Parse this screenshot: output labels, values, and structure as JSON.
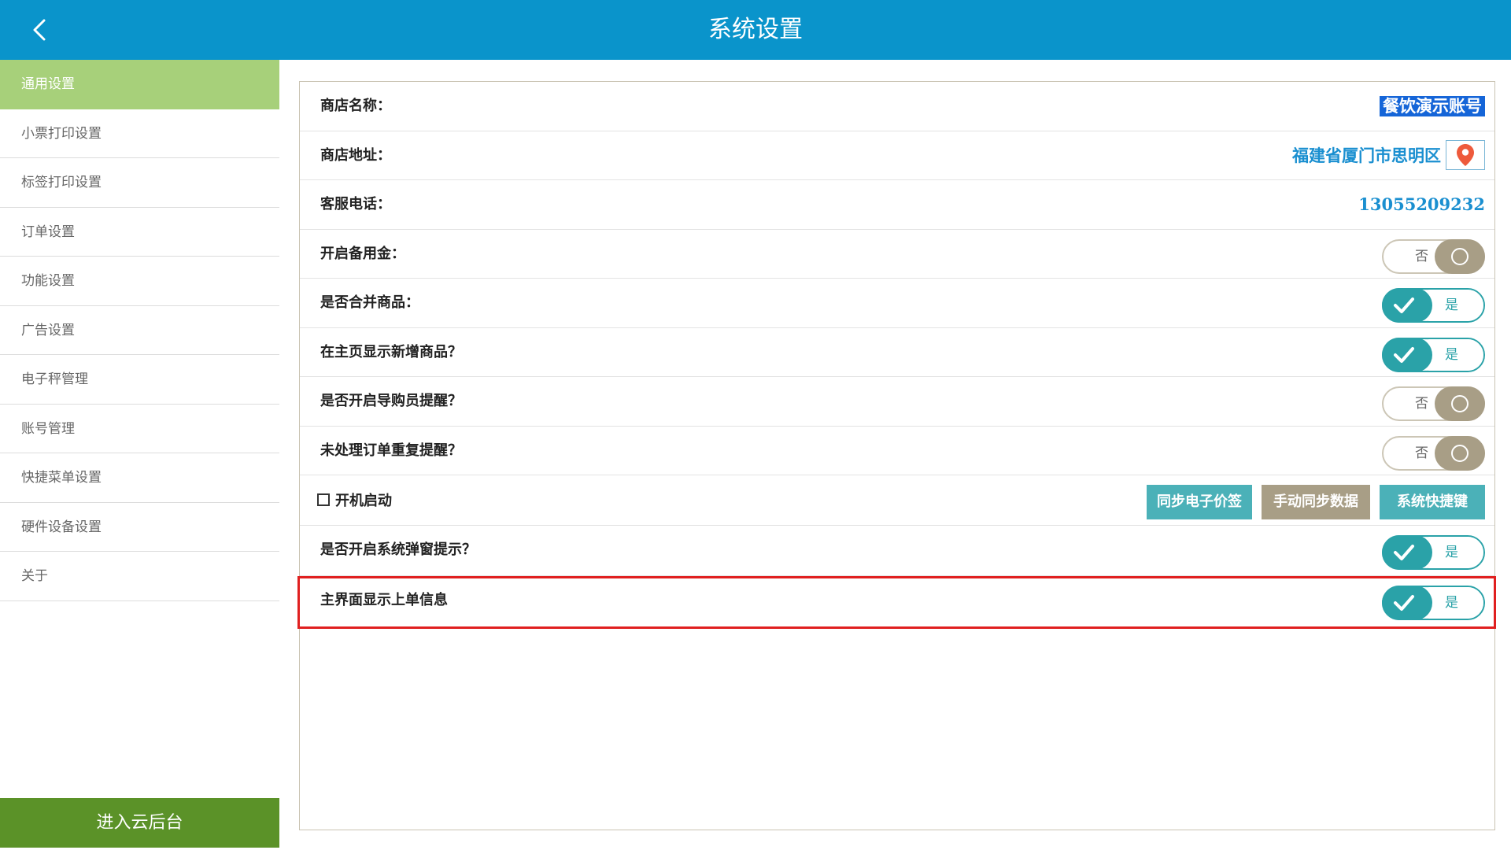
{
  "header": {
    "title": "系统设置",
    "back_icon": "chevron-left-icon"
  },
  "sidebar": {
    "items": [
      {
        "label": "通用设置",
        "active": true
      },
      {
        "label": "小票打印设置"
      },
      {
        "label": "标签打印设置"
      },
      {
        "label": "订单设置"
      },
      {
        "label": "功能设置"
      },
      {
        "label": "广告设置"
      },
      {
        "label": "电子秤管理"
      },
      {
        "label": "账号管理"
      },
      {
        "label": "快捷菜单设置"
      },
      {
        "label": "硬件设备设置"
      },
      {
        "label": "关于"
      }
    ],
    "cloud_button": "进入云后台"
  },
  "settings": {
    "store_name_label": "商店名称：",
    "store_name_value": "餐饮演示账号",
    "store_address_label": "商店地址：",
    "store_address_value": "福建省厦门市思明区",
    "service_phone_label": "客服电话：",
    "service_phone_value": "13055209232",
    "petty_cash_label": "开启备用金：",
    "petty_cash_state": "否",
    "merge_goods_label": "是否合并商品：",
    "merge_goods_state": "是",
    "show_new_goods_label": "在主页显示新增商品？",
    "show_new_goods_state": "是",
    "guide_reminder_label": "是否开启导购员提醒？",
    "guide_reminder_state": "否",
    "repeat_reminder_label": "未处理订单重复提醒？",
    "repeat_reminder_state": "否",
    "boot_start_label": "开机启动",
    "boot_start_checked": false,
    "sync_price_tag_button": "同步电子价签",
    "manual_sync_button": "手动同步数据",
    "shortcut_button": "系统快捷键",
    "popup_hint_label": "是否开启系统弹窗提示？",
    "popup_hint_state": "是",
    "show_order_info_label": "主界面显示上单信息",
    "show_order_info_state": "是"
  },
  "colors": {
    "header": "#0a94cb",
    "sidebar_active": "#a7d07a",
    "cloud_button": "#5b9228",
    "toggle_on": "#2aa2a8",
    "toggle_off": "#a89e86",
    "highlight": "#e02020"
  }
}
